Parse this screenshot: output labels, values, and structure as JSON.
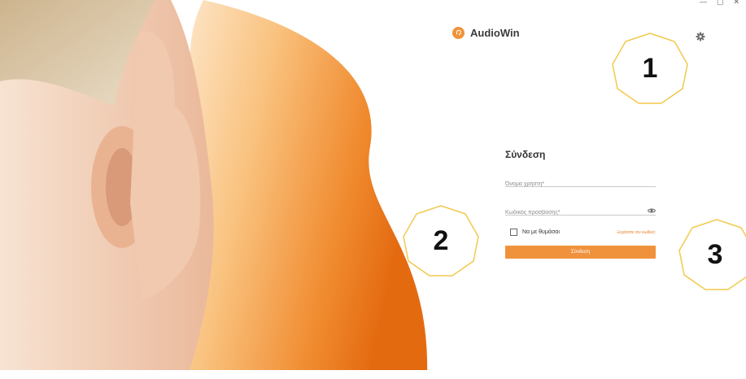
{
  "app": {
    "name": "AudioWin"
  },
  "window_controls": [
    "—",
    "▢",
    "✕"
  ],
  "login": {
    "title": "Σύνδεση",
    "username_placeholder": "Όνομα χρήστη*",
    "password_placeholder": "Κωδικός πρόσβασης*",
    "remember_label": "Να με θυμάσαι",
    "remember_checked": false,
    "forgot_link": "Ξεχάσατε τον κωδικό;",
    "submit_label": "Σύνδεση"
  },
  "callouts": [
    "1",
    "2",
    "3"
  ],
  "colors": {
    "accent": "#f0923c",
    "callout_border": "#f2c94c"
  }
}
